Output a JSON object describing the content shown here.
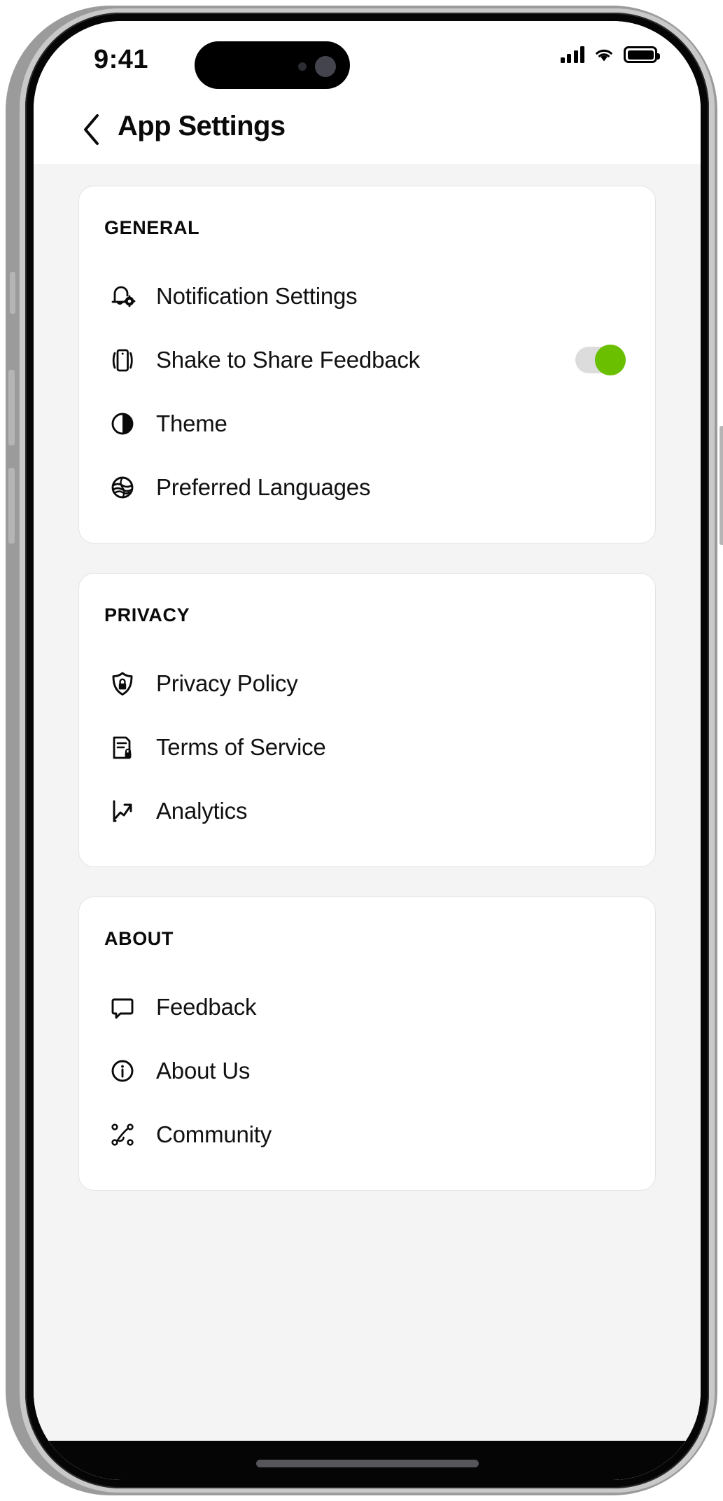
{
  "status_bar": {
    "time": "9:41",
    "signal_icon": "cellular-signal-icon",
    "wifi_icon": "wifi-icon",
    "battery_icon": "battery-full-icon"
  },
  "nav": {
    "back_icon": "chevron-left-icon",
    "title": "App Settings"
  },
  "sections": [
    {
      "title": "GENERAL",
      "rows": [
        {
          "icon": "bell-gear-icon",
          "label": "Notification Settings",
          "control": "none"
        },
        {
          "icon": "phone-shake-icon",
          "label": "Shake to Share Feedback",
          "control": "toggle",
          "toggle_on": true
        },
        {
          "icon": "contrast-half-circle-icon",
          "label": "Theme",
          "control": "none"
        },
        {
          "icon": "language-globe-icon",
          "label": "Preferred Languages",
          "control": "none"
        }
      ]
    },
    {
      "title": "PRIVACY",
      "rows": [
        {
          "icon": "shield-lock-icon",
          "label": "Privacy Policy",
          "control": "none"
        },
        {
          "icon": "document-lock-icon",
          "label": "Terms of Service",
          "control": "none"
        },
        {
          "icon": "trending-up-icon",
          "label": "Analytics",
          "control": "none"
        }
      ]
    },
    {
      "title": "ABOUT",
      "rows": [
        {
          "icon": "speech-bubble-icon",
          "label": "Feedback",
          "control": "none"
        },
        {
          "icon": "info-circle-icon",
          "label": "About Us",
          "control": "none"
        },
        {
          "icon": "network-nodes-icon",
          "label": "Community",
          "control": "none"
        }
      ]
    }
  ],
  "colors": {
    "toggle_on": "#6abf00",
    "toggle_track": "#dcdcdc",
    "page_background": "#f4f4f5",
    "card_background": "#ffffff",
    "text_primary": "#111113"
  }
}
